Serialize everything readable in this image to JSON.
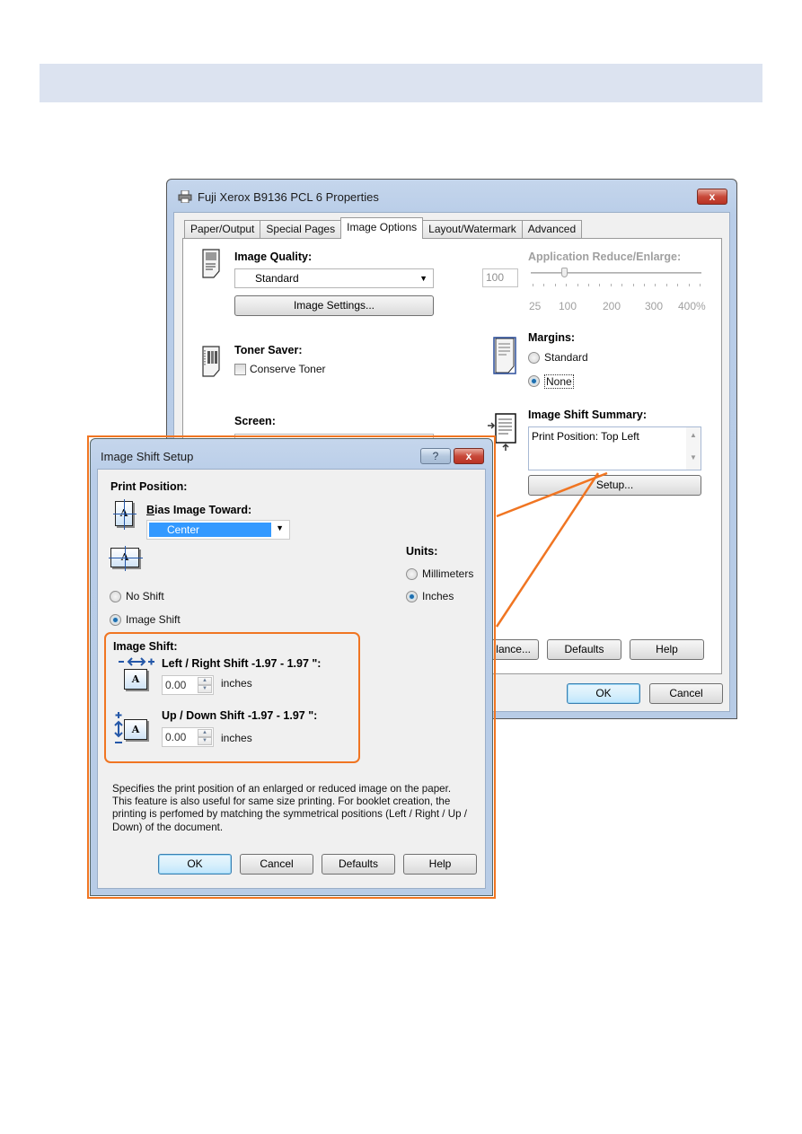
{
  "main_window": {
    "title": "Fuji Xerox B9136 PCL 6 Properties",
    "close_glyph": "x",
    "tabs": [
      {
        "label": "Paper/Output",
        "active": false
      },
      {
        "label": "Special Pages",
        "active": false
      },
      {
        "label": "Image Options",
        "active": true
      },
      {
        "label": "Layout/Watermark",
        "active": false
      },
      {
        "label": "Advanced",
        "active": false
      }
    ],
    "image_quality": {
      "label": "Image Quality:",
      "value": "Standard",
      "settings_button": "Image Settings..."
    },
    "reduce_enlarge": {
      "label": "Application Reduce/Enlarge:",
      "value": "100",
      "slider_value_percent": 100,
      "slider_range": [
        25,
        400
      ],
      "tick_labels": [
        "25",
        "100",
        "200",
        "300",
        "400%"
      ],
      "enabled": false
    },
    "toner_saver": {
      "label": "Toner Saver:",
      "checkbox_label": "Conserve Toner",
      "checked": false
    },
    "margins": {
      "label": "Margins:",
      "options": [
        {
          "label": "Standard",
          "selected": false
        },
        {
          "label": "None",
          "selected": true
        }
      ]
    },
    "screen": {
      "label": "Screen:"
    },
    "image_shift_summary": {
      "label": "Image Shift Summary:",
      "text": "Print Position: Top Left",
      "setup_button": "Setup..."
    },
    "panel_buttons": {
      "balance": "lance...",
      "defaults": "Defaults",
      "help": "Help"
    },
    "footer_buttons": {
      "ok": "OK",
      "cancel": "Cancel"
    }
  },
  "shift_dialog": {
    "title": "Image Shift Setup",
    "help_glyph": "?",
    "close_glyph": "x",
    "print_position_label": "Print Position:",
    "bias_label": "Bias Image Toward:",
    "bias_value": "Center",
    "no_shift_label": "No Shift",
    "image_shift_label": "Image Shift",
    "shift_mode": "Image Shift",
    "units": {
      "label": "Units:",
      "options": [
        {
          "label": "Millimeters",
          "selected": false
        },
        {
          "label": "Inches",
          "selected": true
        }
      ]
    },
    "image_shift_group": {
      "label": "Image Shift:",
      "left_right": {
        "label": "Left / Right Shift -1.97 - 1.97 \":",
        "value": "0.00",
        "unit": "inches"
      },
      "up_down": {
        "label": "Up / Down Shift -1.97 - 1.97 \":",
        "value": "0.00",
        "unit": "inches"
      }
    },
    "description": "Specifies the print position of an enlarged or reduced image on the paper. This feature is also useful for same size printing. For booklet creation, the printing is perfomed by matching the symmetrical positions (Left / Right / Up / Down) of the document.",
    "buttons": {
      "ok": "OK",
      "cancel": "Cancel",
      "defaults": "Defaults",
      "help": "Help"
    }
  },
  "colors": {
    "banner": "#dce3f0",
    "callout_orange": "#f07522",
    "selection_blue": "#3399ff"
  }
}
